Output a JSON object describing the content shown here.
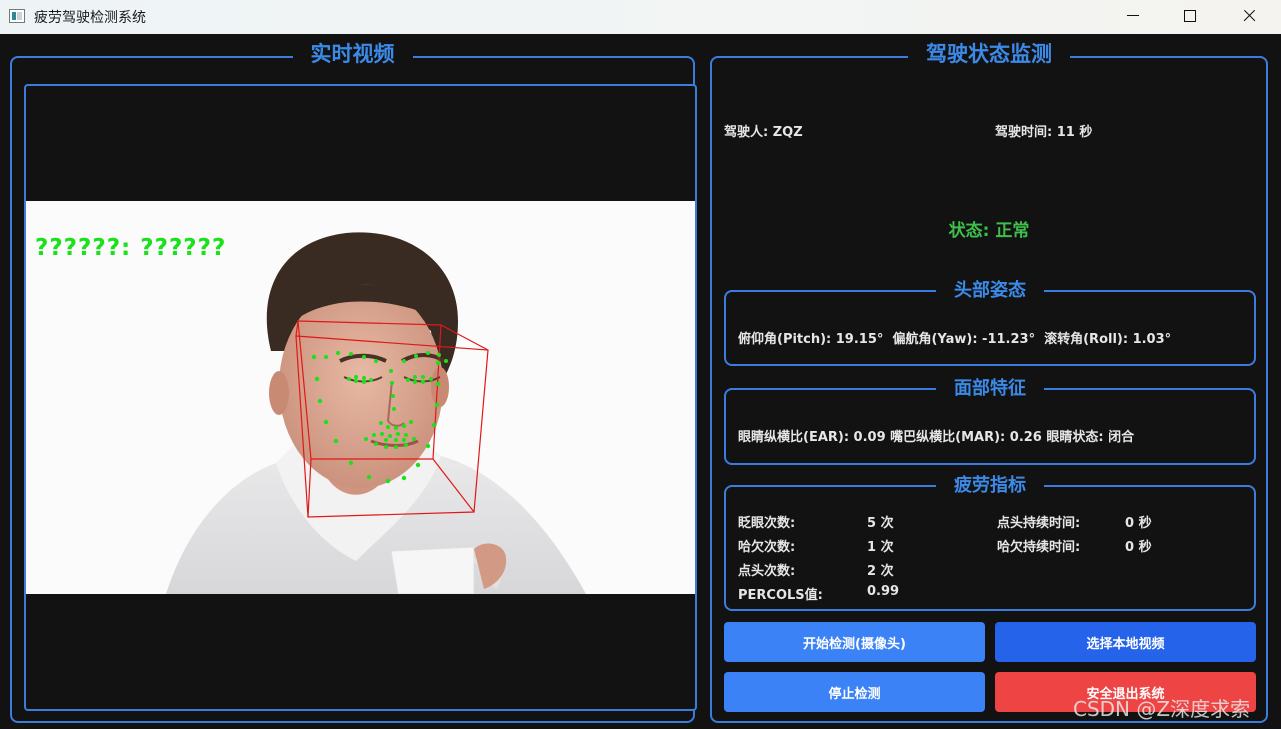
{
  "window": {
    "title": "疲劳驾驶检测系统"
  },
  "video_panel": {
    "title": "实时视频",
    "overlay_text": "??????: ??????"
  },
  "status_panel": {
    "title": "驾驶状态监测",
    "driver": "驾驶人: ZQZ",
    "drive_time": "驾驶时间: 11 秒",
    "status": "状态: 正常",
    "status_color": "#3fbf4a",
    "head_pose": {
      "title": "头部姿态",
      "text": "俯仰角(Pitch): 19.15°  偏航角(Yaw): -11.23°  滚转角(Roll): 1.03°"
    },
    "face_features": {
      "title": "面部特征",
      "text": "眼睛纵横比(EAR): 0.09 嘴巴纵横比(MAR): 0.26 眼睛状态: 闭合"
    },
    "fatigue": {
      "title": "疲劳指标",
      "blink_label": "眨眼次数:",
      "blink_value": "5 次",
      "yawn_label": "哈欠次数:",
      "yawn_value": "1 次",
      "nod_label": "点头次数:",
      "nod_value": "2 次",
      "perclos_label": "PERCOLS值:",
      "perclos_value": "0.99",
      "nod_duration_label": "点头持续时间:",
      "nod_duration_value": "0 秒",
      "yawn_duration_label": "哈欠持续时间:",
      "yawn_duration_value": "0 秒"
    },
    "buttons": {
      "start_camera": "开始检测(摄像头)",
      "select_local": "选择本地视频",
      "stop": "停止检测",
      "exit": "安全退出系统"
    }
  },
  "watermark": "CSDN @Z深度求索",
  "colors": {
    "accent": "#3b7ddd",
    "landmark": "#19e21a",
    "pose_box": "#e01818",
    "exit": "#ef4444"
  }
}
